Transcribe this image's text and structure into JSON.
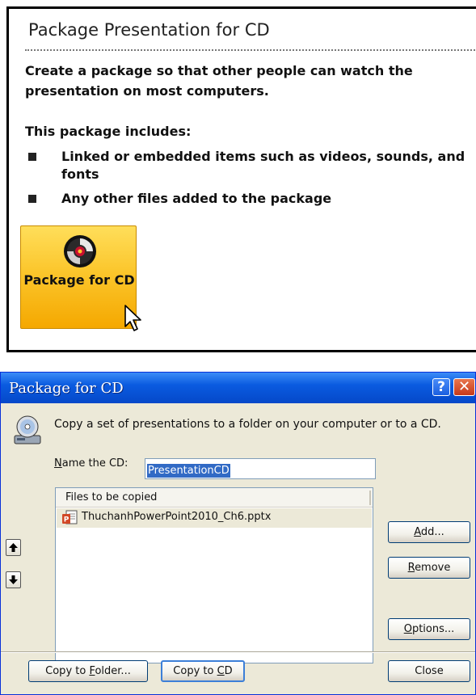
{
  "top_panel": {
    "title": "Package Presentation for CD",
    "description": "Create a package so that other people can watch the presentation on most computers.",
    "includes_heading": "This package includes:",
    "bullets": [
      "Linked or embedded items such as videos, sounds, and fonts",
      "Any other files added to the package"
    ],
    "button": {
      "label": "Package for CD",
      "icon": "cd-disc-icon",
      "color": "#fbc62c"
    }
  },
  "dialog": {
    "title": "Package for CD",
    "help_label": "?",
    "close_label": "✕",
    "description": "Copy a set of presentations to a folder on your computer or to a CD.",
    "name_label": "Name the CD:",
    "name_value": "PresentationCD",
    "files_header": "Files to be copied",
    "files": [
      "ThuchanhPowerPoint2010_Ch6.pptx"
    ],
    "buttons": {
      "add": "Add...",
      "remove": "Remove",
      "options": "Options...",
      "copy_to_folder": "Copy to Folder...",
      "copy_to_cd": "Copy to CD",
      "close": "Close"
    },
    "colors": {
      "title_bar": "#0a5be0",
      "body": "#ece9d8",
      "selection": "#316ac5"
    }
  }
}
